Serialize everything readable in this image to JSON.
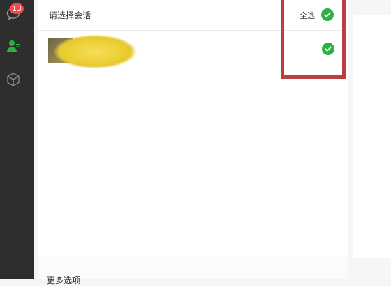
{
  "sidebar": {
    "chat_badge": "13",
    "icons": [
      "chat-bubble-icon",
      "contacts-icon",
      "cube-icon"
    ]
  },
  "panel": {
    "header_title": "请选择会话",
    "select_all_label": "全选",
    "footer_label": "更多选项"
  },
  "conversation": {
    "name_obscured": true,
    "selected": true
  },
  "colors": {
    "check_green": "#2bb33f",
    "highlight_red": "#b84040",
    "badge_red": "#f34b4b",
    "sidebar_bg": "#2e2e2e"
  }
}
